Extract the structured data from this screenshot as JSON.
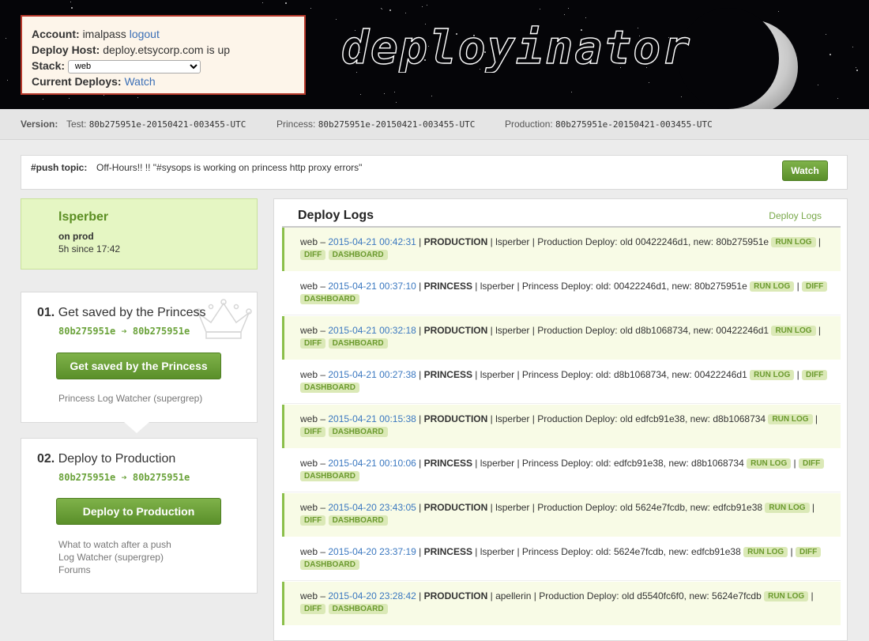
{
  "account": {
    "account_label": "Account:",
    "user": "imalpass",
    "logout": "logout",
    "host_label": "Deploy Host:",
    "host_value": "deploy.etsycorp.com is up",
    "stack_label": "Stack:",
    "stack_value": "web",
    "deploys_label": "Current Deploys:",
    "deploys_link": "Watch"
  },
  "logo_text": "deployinator",
  "versions": {
    "label": "Version:",
    "test_label": "Test:",
    "test_value": "80b275951e-20150421-003455-UTC",
    "princess_label": "Princess:",
    "princess_value": "80b275951e-20150421-003455-UTC",
    "production_label": "Production:",
    "production_value": "80b275951e-20150421-003455-UTC"
  },
  "push_topic": {
    "label": "#push topic:",
    "text": "Off-Hours!! !! \"#sysops is working on princess http proxy errors\"",
    "watch": "Watch"
  },
  "current_deploy": {
    "name": "lsperber",
    "status": "on prod",
    "time": "5h since 17:42"
  },
  "steps": [
    {
      "num": "01.",
      "title": "Get saved by the Princess",
      "hash": "80b275951e ➔ 80b275951e",
      "button": "Get saved by the Princess",
      "links": [
        "Princess Log Watcher (supergrep)"
      ]
    },
    {
      "num": "02.",
      "title": "Deploy to Production",
      "hash": "80b275951e ➔ 80b275951e",
      "button": "Deploy to Production",
      "links": [
        "What to watch after a push",
        "Log Watcher (supergrep)",
        "Forums"
      ]
    }
  ],
  "logs": {
    "title": "Deploy Logs",
    "link": "Deploy Logs",
    "tags": {
      "run": "RUN LOG",
      "diff": "DIFF",
      "dashboard": "DASHBOARD"
    },
    "rows": [
      {
        "stack": "web –",
        "ts": "2015-04-21 00:42:31",
        "stage": "PRODUCTION",
        "text": " | lsperber | Production Deploy: old 00422246d1, new: 80b275951e",
        "type": "prod"
      },
      {
        "stack": "web –",
        "ts": "2015-04-21 00:37:10",
        "stage": "PRINCESS",
        "text": " | lsperber | Princess Deploy: old: 00422246d1, new: 80b275951e",
        "type": "princess"
      },
      {
        "stack": "web –",
        "ts": "2015-04-21 00:32:18",
        "stage": "PRODUCTION",
        "text": " | lsperber | Production Deploy: old d8b1068734, new: 00422246d1",
        "type": "prod"
      },
      {
        "stack": "web –",
        "ts": "2015-04-21 00:27:38",
        "stage": "PRINCESS",
        "text": " | lsperber | Princess Deploy: old: d8b1068734, new: 00422246d1",
        "type": "princess"
      },
      {
        "stack": "web –",
        "ts": "2015-04-21 00:15:38",
        "stage": "PRODUCTION",
        "text": " | lsperber | Production Deploy: old edfcb91e38, new: d8b1068734",
        "type": "prod"
      },
      {
        "stack": "web –",
        "ts": "2015-04-21 00:10:06",
        "stage": "PRINCESS",
        "text": " | lsperber | Princess Deploy: old: edfcb91e38, new: d8b1068734",
        "type": "princess"
      },
      {
        "stack": "web –",
        "ts": "2015-04-20 23:43:05",
        "stage": "PRODUCTION",
        "text": " | lsperber | Production Deploy: old 5624e7fcdb, new: edfcb91e38",
        "type": "prod"
      },
      {
        "stack": "web –",
        "ts": "2015-04-20 23:37:19",
        "stage": "PRINCESS",
        "text": " | lsperber | Princess Deploy: old: 5624e7fcdb, new: edfcb91e38",
        "type": "princess"
      },
      {
        "stack": "web –",
        "ts": "2015-04-20 23:28:42",
        "stage": "PRODUCTION",
        "text": " | apellerin | Production Deploy: old d5540fc6f0, new: 5624e7fcdb",
        "type": "prod"
      }
    ]
  }
}
